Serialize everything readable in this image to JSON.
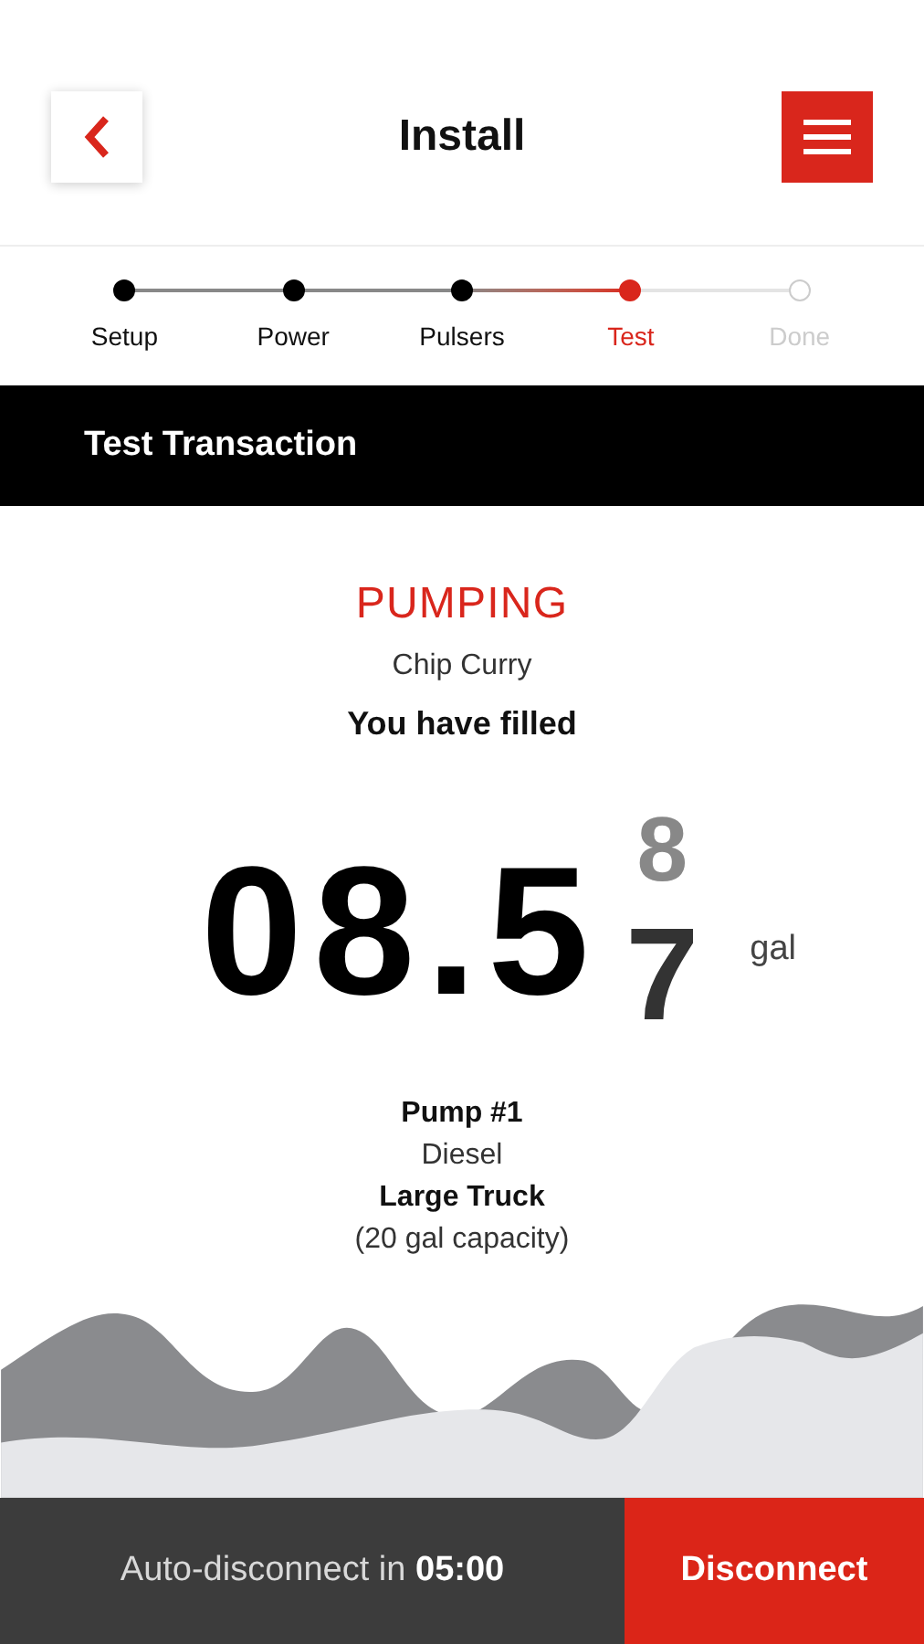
{
  "header": {
    "title": "Install"
  },
  "steps": [
    {
      "label": "Setup",
      "completed": true,
      "selected": false
    },
    {
      "label": "Power",
      "completed": true,
      "selected": false
    },
    {
      "label": "Pulsers",
      "completed": true,
      "selected": false
    },
    {
      "label": "Test",
      "completed": false,
      "selected": true
    },
    {
      "label": "Done",
      "completed": false,
      "selected": false
    }
  ],
  "section": {
    "title": "Test Transaction"
  },
  "status": "PUMPING",
  "customer": "Chip Curry",
  "filled_label": "You have filled",
  "reading": {
    "value": "08.5",
    "rolling_digits": [
      "8",
      "7"
    ],
    "unit": "gal"
  },
  "pump": {
    "name": "Pump #1",
    "fuel": "Diesel",
    "vehicle": "Large Truck",
    "capacity": "(20 gal capacity)"
  },
  "footer": {
    "countdown_label": "Auto-disconnect in",
    "countdown": "05:00",
    "button": "Disconnect"
  }
}
